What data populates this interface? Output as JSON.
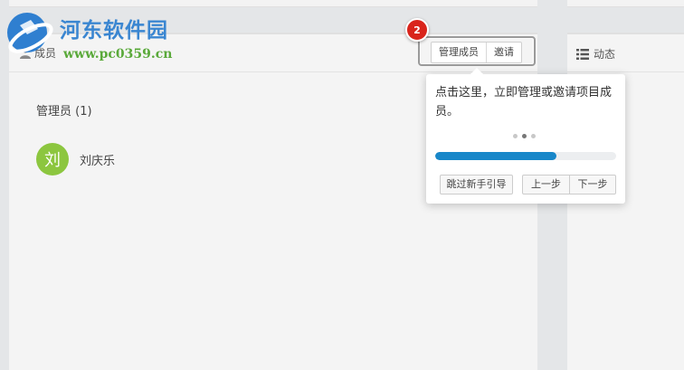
{
  "watermark": {
    "title": "河东软件园",
    "url": "www.pc0359.cn"
  },
  "members_panel": {
    "title": "成员",
    "buttons": {
      "manage": "管理成员",
      "invite": "邀请"
    },
    "section_label": "管理员 (1)",
    "members": [
      {
        "avatar_text": "刘",
        "name": "刘庆乐",
        "avatar_color": "#8cc63f"
      }
    ]
  },
  "activity_panel": {
    "title": "动态"
  },
  "guide": {
    "step_number": "2",
    "text": "点击这里，立即管理或邀请项目成员。",
    "dots_total": 3,
    "dots_active": 2,
    "progress_fraction": 0.67,
    "skip_label": "跳过新手引导",
    "prev_label": "上一步",
    "next_label": "下一步"
  },
  "colors": {
    "accent_blue": "#1887c9",
    "badge_red": "#d9241b",
    "avatar_green": "#8cc63f"
  }
}
